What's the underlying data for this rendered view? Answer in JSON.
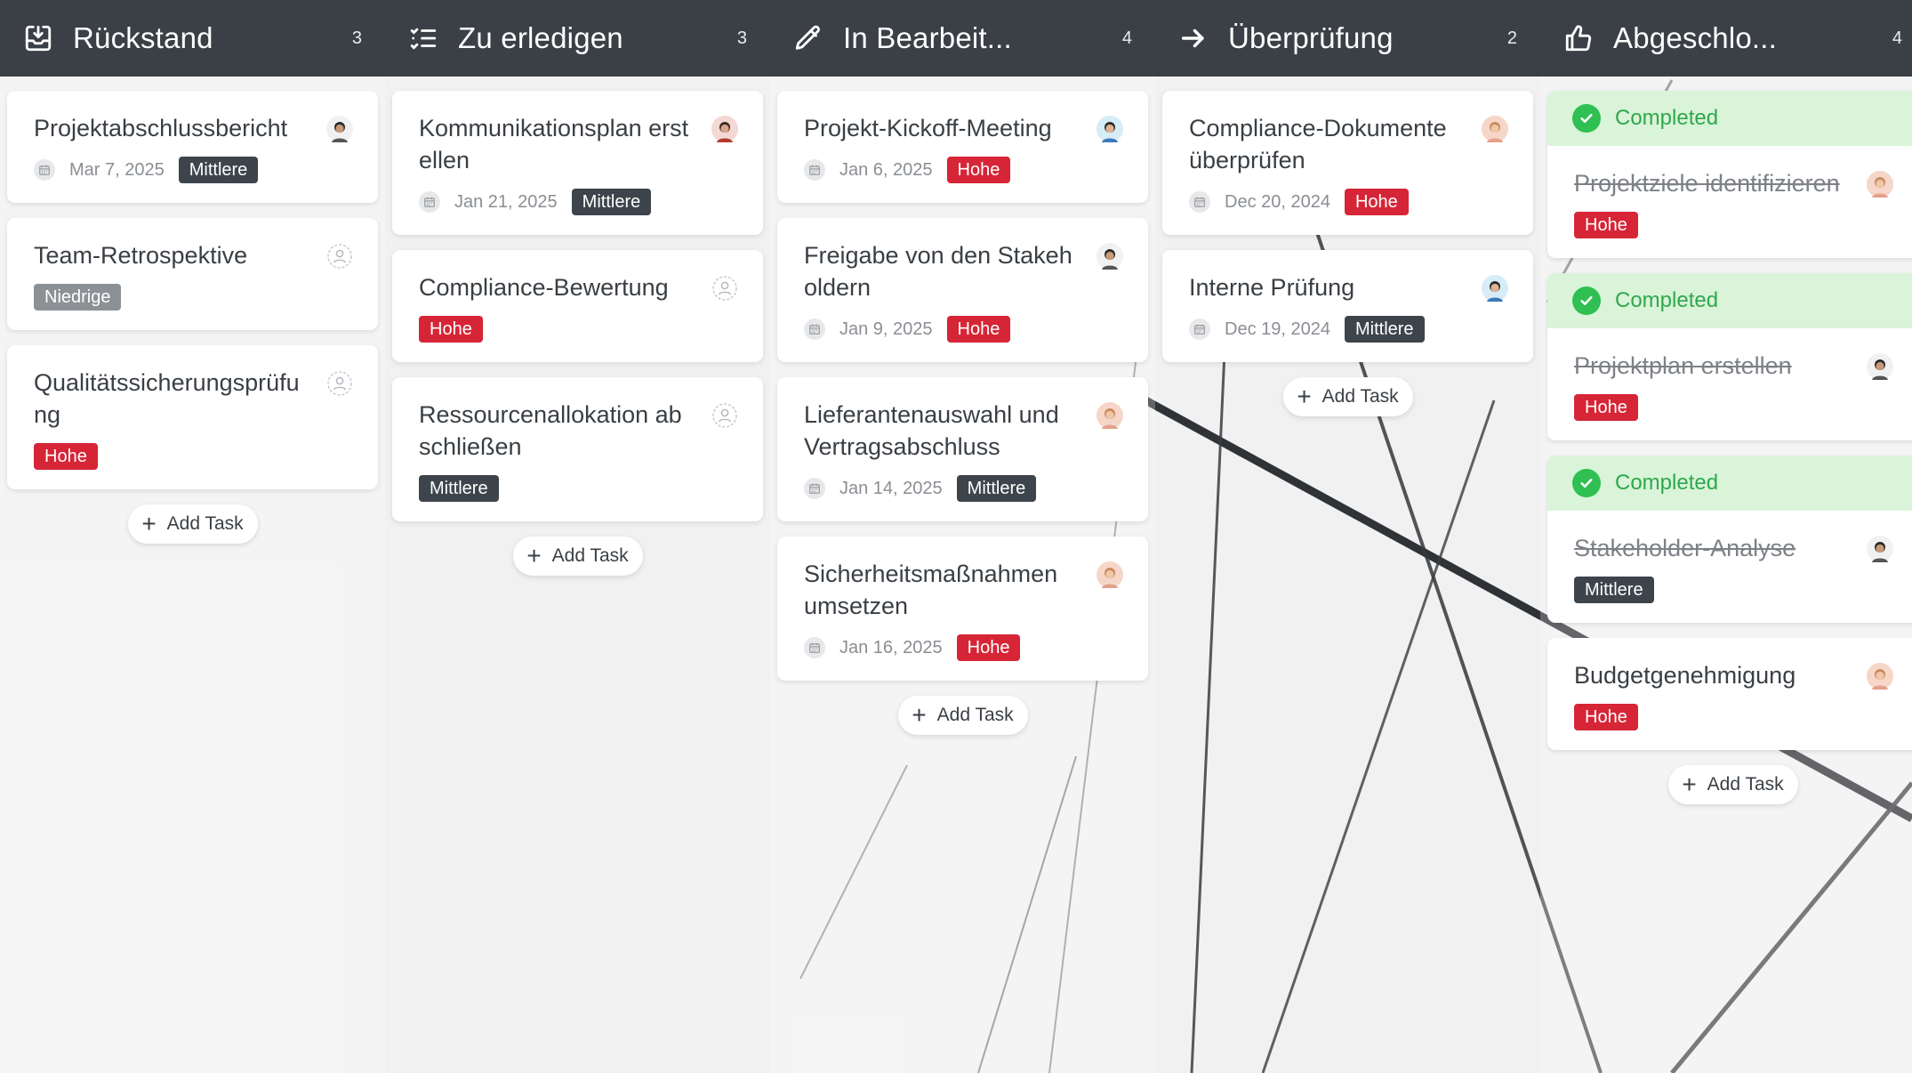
{
  "columns": [
    {
      "title": "Rückstand",
      "count": "3",
      "icon": "inbox-icon",
      "add_label": "Add Task",
      "cards": [
        {
          "title": "Projektabschlussbericht",
          "date": "Mar 7, 2025",
          "priority": "Mittlere",
          "avatar": "man-dark"
        },
        {
          "title": "Team-Retrospektive",
          "date": "",
          "priority": "Niedrige",
          "avatar": "empty"
        },
        {
          "title": "Qualitätssicherungsprüfung",
          "date": "",
          "priority": "Hohe",
          "avatar": "empty"
        }
      ]
    },
    {
      "title": "Zu erledigen",
      "count": "3",
      "icon": "list-icon",
      "add_label": "Add Task",
      "cards": [
        {
          "title": "Kommunikationsplan erstellen",
          "date": "Jan 21, 2025",
          "priority": "Mittlere",
          "avatar": "man-red"
        },
        {
          "title": "Compliance-Bewertung",
          "date": "",
          "priority": "Hohe",
          "avatar": "empty"
        },
        {
          "title": "Ressourcenallokation abschließen",
          "date": "",
          "priority": "Mittlere",
          "avatar": "empty"
        }
      ]
    },
    {
      "title": "In Bearbeit...",
      "count": "4",
      "icon": "pencil-icon",
      "add_label": "Add Task",
      "cards": [
        {
          "title": "Projekt-Kickoff-Meeting",
          "date": "Jan 6, 2025",
          "priority": "Hohe",
          "avatar": "man-blue"
        },
        {
          "title": "Freigabe von den Stakeholdern",
          "date": "Jan 9, 2025",
          "priority": "Hohe",
          "avatar": "man-dark"
        },
        {
          "title": "Lieferantenauswahl und Vertragsabschluss",
          "date": "Jan 14, 2025",
          "priority": "Mittlere",
          "avatar": "woman"
        },
        {
          "title": "Sicherheitsmaßnahmen umsetzen",
          "date": "Jan 16, 2025",
          "priority": "Hohe",
          "avatar": "woman"
        }
      ]
    },
    {
      "title": "Überprüfung",
      "count": "2",
      "icon": "arrow-right-icon",
      "add_label": "Add Task",
      "cards": [
        {
          "title": "Compliance-Dokumente überprüfen",
          "date": "Dec 20, 2024",
          "priority": "Hohe",
          "avatar": "woman"
        },
        {
          "title": "Interne Prüfung",
          "date": "Dec 19, 2024",
          "priority": "Mittlere",
          "avatar": "man-blue"
        }
      ]
    },
    {
      "title": "Abgeschlo...",
      "count": "4",
      "icon": "thumbs-up-icon",
      "add_label": "Add Task",
      "cards": [
        {
          "completed": "Completed",
          "title": "Projektziele identifizieren",
          "date": "",
          "priority": "Hohe",
          "avatar": "woman"
        },
        {
          "completed": "Completed",
          "title": "Projektplan erstellen",
          "date": "",
          "priority": "Hohe",
          "avatar": "man-dark"
        },
        {
          "completed": "Completed",
          "title": "Stakeholder-Analyse",
          "date": "",
          "priority": "Mittlere",
          "avatar": "man-dark"
        },
        {
          "title": "Budgetgenehmigung",
          "date": "",
          "priority": "Hohe",
          "avatar": "woman"
        }
      ]
    }
  ],
  "colors": {
    "header_bg": "#3a4046",
    "priority_hohe": "#d62536",
    "priority_mittlere": "#3d444b",
    "priority_niedrige": "#8c9196",
    "completed_bg": "#d9f4d8",
    "completed_check": "#2fbf52"
  }
}
